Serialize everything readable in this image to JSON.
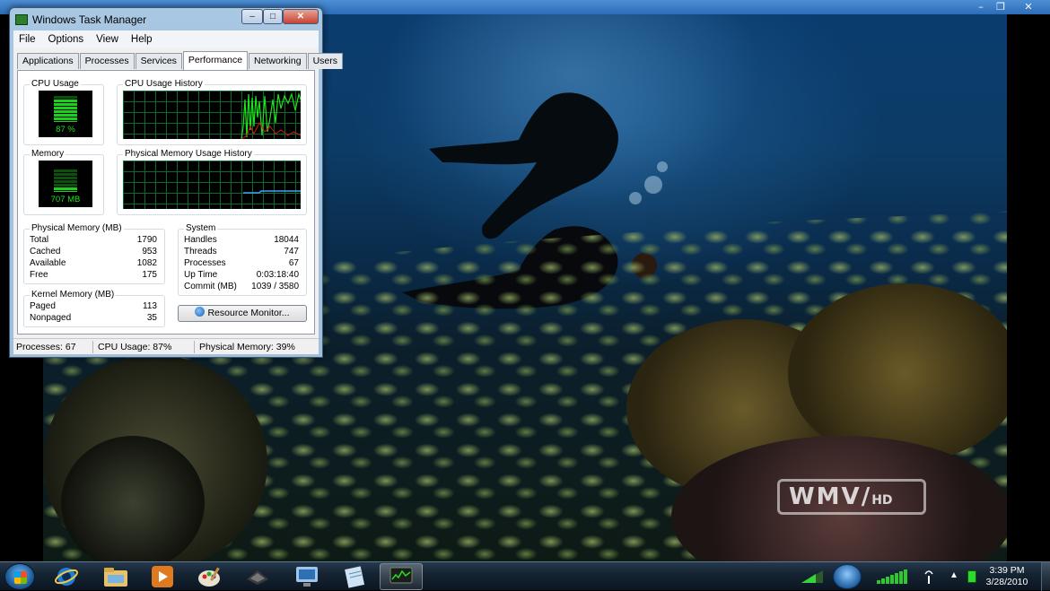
{
  "player": {
    "minimize_icon": "minimize-icon",
    "restore_icon": "restore-icon",
    "close_icon": "close-icon",
    "watermark": {
      "main": "WMV",
      "sub": "HD"
    }
  },
  "task_manager": {
    "title": "Windows Task Manager",
    "menu": [
      "File",
      "Options",
      "View",
      "Help"
    ],
    "tabs": [
      "Applications",
      "Processes",
      "Services",
      "Performance",
      "Networking",
      "Users"
    ],
    "active_tab": "Performance",
    "cpu_usage": {
      "label": "CPU Usage",
      "value": "87 %",
      "percent": 87
    },
    "cpu_history": {
      "label": "CPU Usage History"
    },
    "memory": {
      "label": "Memory",
      "value": "707 MB",
      "fraction": 0.2
    },
    "memory_history": {
      "label": "Physical Memory Usage History"
    },
    "physical_memory": {
      "label": "Physical Memory (MB)",
      "rows": [
        {
          "k": "Total",
          "v": "1790"
        },
        {
          "k": "Cached",
          "v": "953"
        },
        {
          "k": "Available",
          "v": "1082"
        },
        {
          "k": "Free",
          "v": "175"
        }
      ]
    },
    "system": {
      "label": "System",
      "rows": [
        {
          "k": "Handles",
          "v": "18044"
        },
        {
          "k": "Threads",
          "v": "747"
        },
        {
          "k": "Processes",
          "v": "67"
        },
        {
          "k": "Up Time",
          "v": "0:03:18:40"
        },
        {
          "k": "Commit (MB)",
          "v": "1039 / 3580"
        }
      ]
    },
    "kernel_memory": {
      "label": "Kernel Memory (MB)",
      "rows": [
        {
          "k": "Paged",
          "v": "113"
        },
        {
          "k": "Nonpaged",
          "v": "35"
        }
      ]
    },
    "resource_monitor_button": "Resource Monitor...",
    "status": {
      "processes": "Processes: 67",
      "cpu": "CPU Usage: 87%",
      "memory": "Physical Memory: 39%"
    }
  },
  "taskbar": {
    "start_icon": "windows-start-icon",
    "items": [
      {
        "icon": "internet-explorer-icon",
        "active": false
      },
      {
        "icon": "file-explorer-icon",
        "active": false
      },
      {
        "icon": "media-player-icon",
        "active": false
      },
      {
        "icon": "paint-icon",
        "active": false
      },
      {
        "icon": "media-center-icon",
        "active": false
      },
      {
        "icon": "remote-desktop-icon",
        "active": false
      },
      {
        "icon": "notepad-icon",
        "active": false
      },
      {
        "icon": "task-manager-icon",
        "active": true
      }
    ],
    "tray_icons": [
      "cpu-meter-icon",
      "network-adapter-icon",
      "signal-strength-icon",
      "wireless-icon",
      "show-hidden-icons-icon",
      "battery-icon"
    ],
    "clock": {
      "time": "3:39 PM",
      "date": "3/28/2010"
    }
  }
}
